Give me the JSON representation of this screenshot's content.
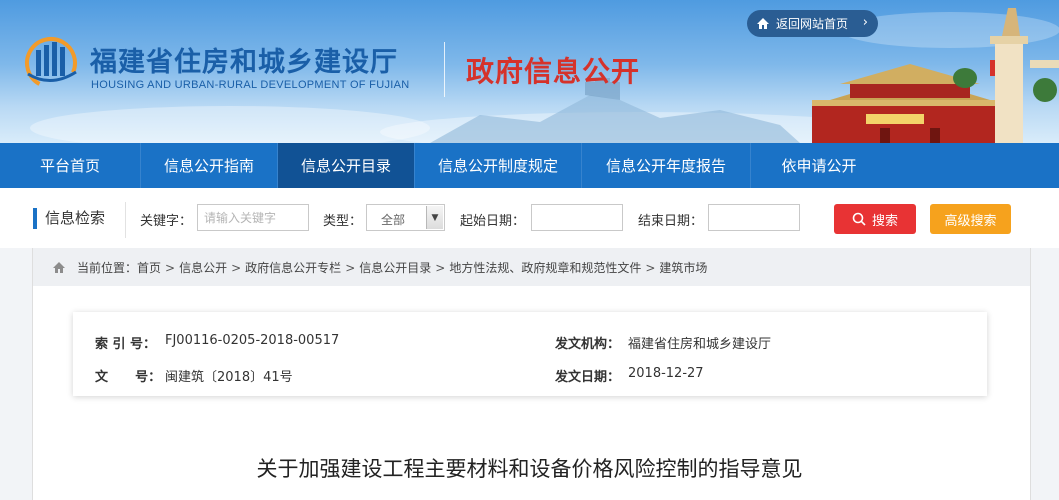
{
  "header": {
    "site_name": "福建省住房和城乡建设厅",
    "site_name_en": "HOUSING AND URBAN-RURAL DEVELOPMENT OF FUJIAN",
    "section_title": "政府信息公开",
    "back_home_label": "返回网站首页",
    "back_home_chevron": "›"
  },
  "nav": {
    "items": [
      {
        "label": "平台首页"
      },
      {
        "label": "信息公开指南"
      },
      {
        "label": "信息公开目录"
      },
      {
        "label": "信息公开制度规定"
      },
      {
        "label": "信息公开年度报告"
      },
      {
        "label": "依申请公开"
      }
    ],
    "active_index": 2
  },
  "search": {
    "title": "信息检索",
    "keyword_label": "关键字：",
    "keyword_placeholder": "请输入关键字",
    "type_label": "类型：",
    "type_value": "全部",
    "start_date_label": "起始日期：",
    "end_date_label": "结束日期：",
    "search_button": "搜索",
    "advanced_button": "高级搜索"
  },
  "breadcrumb": {
    "prefix": "当前位置：",
    "items": [
      "首页",
      "信息公开",
      "政府信息公开专栏",
      "信息公开目录",
      "地方性法规、政府规章和规范性文件",
      "建筑市场"
    ],
    "separator": ">"
  },
  "meta": {
    "index_label": "索 引 号：",
    "index_value": "FJ00116-0205-2018-00517",
    "doc_no_label": "文      号：",
    "doc_no_value": "闽建筑〔2018〕41号",
    "issuer_label": "发文机构：",
    "issuer_value": "福建省住房和城乡建设厅",
    "date_label": "发文日期：",
    "date_value": "2018-12-27"
  },
  "document": {
    "title": "关于加强建设工程主要材料和设备价格风险控制的指导意见"
  },
  "colors": {
    "nav_bg": "#1a72c6",
    "nav_active": "#115295",
    "site_name": "#1a5fa8",
    "section_title": "#d5322b",
    "search_button": "#e83334",
    "advanced_button": "#f6a21d"
  }
}
